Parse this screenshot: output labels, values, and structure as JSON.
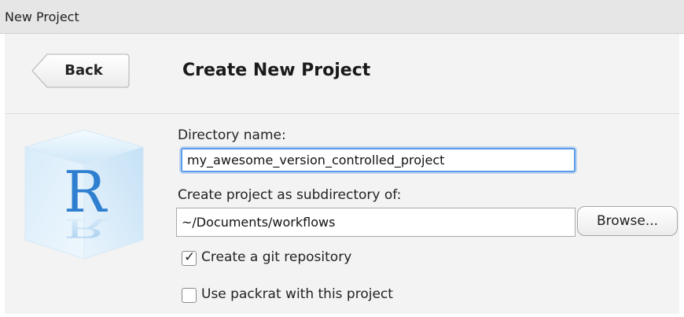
{
  "window": {
    "title": "New Project"
  },
  "header": {
    "back_label": "Back",
    "page_title": "Create New Project"
  },
  "logo": {
    "letter": "R"
  },
  "form": {
    "directory_label": "Directory name:",
    "directory_value": "my_awesome_version_controlled_project",
    "subdirectory_label": "Create project as subdirectory of:",
    "subdirectory_value": "~/Documents/workflows",
    "browse_label": "Browse...",
    "git_repo_label": "Create a git repository",
    "git_repo_checked": true,
    "packrat_label": "Use packrat with this project",
    "packrat_checked": false
  },
  "colors": {
    "focus_ring": "#5b9bea",
    "logo_blue": "#2f7fd0"
  }
}
